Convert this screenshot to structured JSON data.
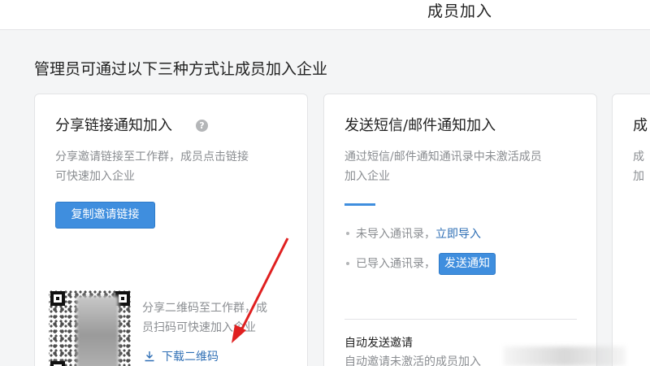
{
  "header": {
    "title": "成员加入"
  },
  "page": {
    "heading": "管理员可通过以下三种方式让成员加入企业"
  },
  "card_share": {
    "title": "分享链接通知加入",
    "help_glyph": "?",
    "desc_line1": "分享邀请链接至工作群，成员点击链接",
    "desc_line2": "可快速加入企业",
    "copy_button": "复制邀请链接",
    "qr_desc_line1": "分享二维码至工作群，成",
    "qr_desc_line2": "员扫码可快速加入企业",
    "download_label": "下载二维码"
  },
  "card_sms": {
    "title": "发送短信/邮件通知加入",
    "desc_line1": "通过短信/邮件通知通讯录中未激活成员",
    "desc_line2": "加入企业",
    "not_imported_text": "未导入通讯录，",
    "import_now_link": "立即导入",
    "imported_text": "已导入通讯录，",
    "send_button": "发送通知",
    "auto_title": "自动发送邀请",
    "auto_desc": "自动邀请未激活的成员加入"
  },
  "card_third": {
    "title_partial": "成",
    "desc_partial_line1": "成",
    "desc_partial_line2": "加"
  },
  "colors": {
    "accent": "#3f8ede",
    "link": "#2f6fb5",
    "annotation_arrow": "#e02020"
  },
  "icons": {
    "help": "question-circle-icon",
    "download": "download-icon"
  }
}
